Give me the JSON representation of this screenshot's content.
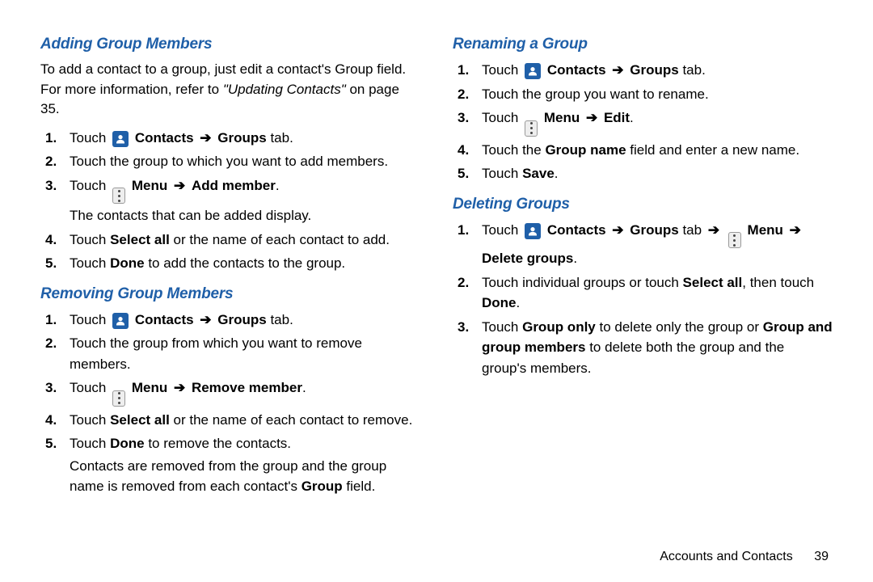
{
  "left": {
    "adding": {
      "title": "Adding Group Members",
      "intro_1": "To add a contact to a group, just edit a contact's Group field. For more information, refer to ",
      "intro_ref": "\"Updating Contacts\"",
      "intro_2": " on page 35.",
      "steps": {
        "s1a": "Touch ",
        "s1_contacts": "Contacts",
        "s1_groups": "Groups",
        "s1_tab": " tab.",
        "s2": "Touch the group to which you want to add members.",
        "s3a": "Touch ",
        "s3_menu": "Menu",
        "s3_add": "Add member",
        "s3_sub": "The contacts that can be added display.",
        "s4a": "Touch ",
        "s4_b": "Select all",
        "s4_c": " or the name of each contact to add.",
        "s5a": "Touch ",
        "s5_b": "Done",
        "s5_c": " to add the contacts to the group."
      }
    },
    "removing": {
      "title": "Removing Group Members",
      "steps": {
        "s1a": "Touch ",
        "s1_contacts": "Contacts",
        "s1_groups": "Groups",
        "s1_tab": " tab.",
        "s2": "Touch the group from which you want to remove members.",
        "s3a": "Touch ",
        "s3_menu": "Menu",
        "s3_rm": "Remove member",
        "s4a": "Touch ",
        "s4_b": "Select all",
        "s4_c": " or the name of each contact to remove.",
        "s5a": "Touch ",
        "s5_b": "Done",
        "s5_c": " to remove the contacts.",
        "s5_sub_a": "Contacts are removed from the group and the group name is removed from each contact's ",
        "s5_sub_b": "Group",
        "s5_sub_c": " field."
      }
    }
  },
  "right": {
    "renaming": {
      "title": "Renaming a Group",
      "steps": {
        "s1a": "Touch ",
        "s1_contacts": "Contacts",
        "s1_groups": "Groups",
        "s1_tab": " tab.",
        "s2": "Touch the group you want to rename.",
        "s3a": "Touch ",
        "s3_menu": "Menu",
        "s3_edit": "Edit",
        "s4a": "Touch the ",
        "s4_b": "Group name",
        "s4_c": " field and enter a new name.",
        "s5a": "Touch ",
        "s5_b": "Save",
        "s5_c": "."
      }
    },
    "deleting": {
      "title": "Deleting Groups",
      "steps": {
        "s1a": "Touch ",
        "s1_contacts": "Contacts",
        "s1_groups": "Groups",
        "s1_tab": " tab ",
        "s1_menu": "Menu",
        "s1_del": "Delete groups",
        "s2a": "Touch individual groups or touch ",
        "s2_b": "Select all",
        "s2_c": ", then touch ",
        "s2_d": "Done",
        "s2_e": ".",
        "s3a": "Touch ",
        "s3_b": "Group only",
        "s3_c": " to delete only the group or ",
        "s3_d": "Group and group members",
        "s3_e": " to delete both the group and the group's members."
      }
    }
  },
  "footer": {
    "section": "Accounts and Contacts",
    "page": "39"
  },
  "glyphs": {
    "arrow": "➔"
  }
}
